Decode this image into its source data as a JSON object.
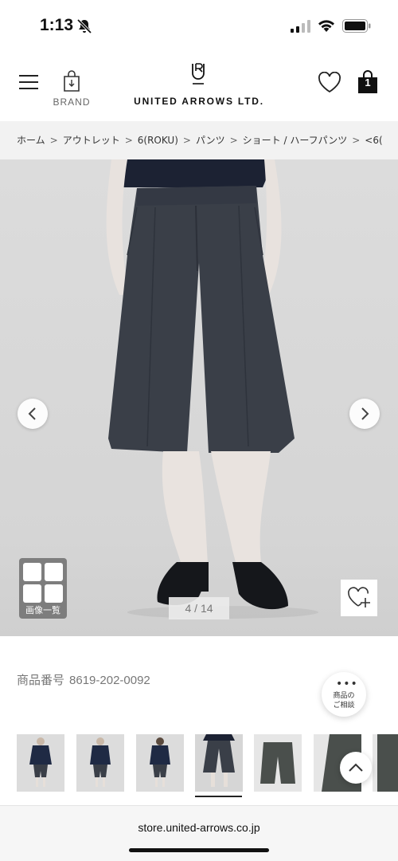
{
  "status_bar": {
    "time": "1:13",
    "icons": [
      "bell-slash-icon",
      "cellular-signal-icon",
      "wifi-icon",
      "battery-icon"
    ]
  },
  "header": {
    "brand_label": "BRAND",
    "logo_text": "UNITED ARROWS LTD.",
    "cart_count": "1",
    "icons": [
      "hamburger-menu-icon",
      "brand-bag-icon",
      "logo-mark-icon",
      "heart-icon",
      "cart-bag-icon"
    ]
  },
  "breadcrumb": {
    "items": [
      "ホーム",
      "アウトレット",
      "6(ROKU)",
      "パンツ",
      "ショート / ハーフパンツ",
      "<6("
    ],
    "separator": ">"
  },
  "gallery": {
    "grid_label": "画像一覧",
    "counter": "4 / 14",
    "current": 4,
    "total": 14
  },
  "product": {
    "code_label": "商品番号",
    "code": "8619-202-0092"
  },
  "consult": {
    "dots": "•••",
    "line1": "商品の",
    "line2": "ご相談"
  },
  "thumbnails": {
    "count_visible": 8,
    "active_index": 3
  },
  "browser": {
    "url": "store.united-arrows.co.jp"
  },
  "colors": {
    "shorts": "#3a3f48",
    "background": "#d8d8d8",
    "text_gray": "#777777"
  }
}
